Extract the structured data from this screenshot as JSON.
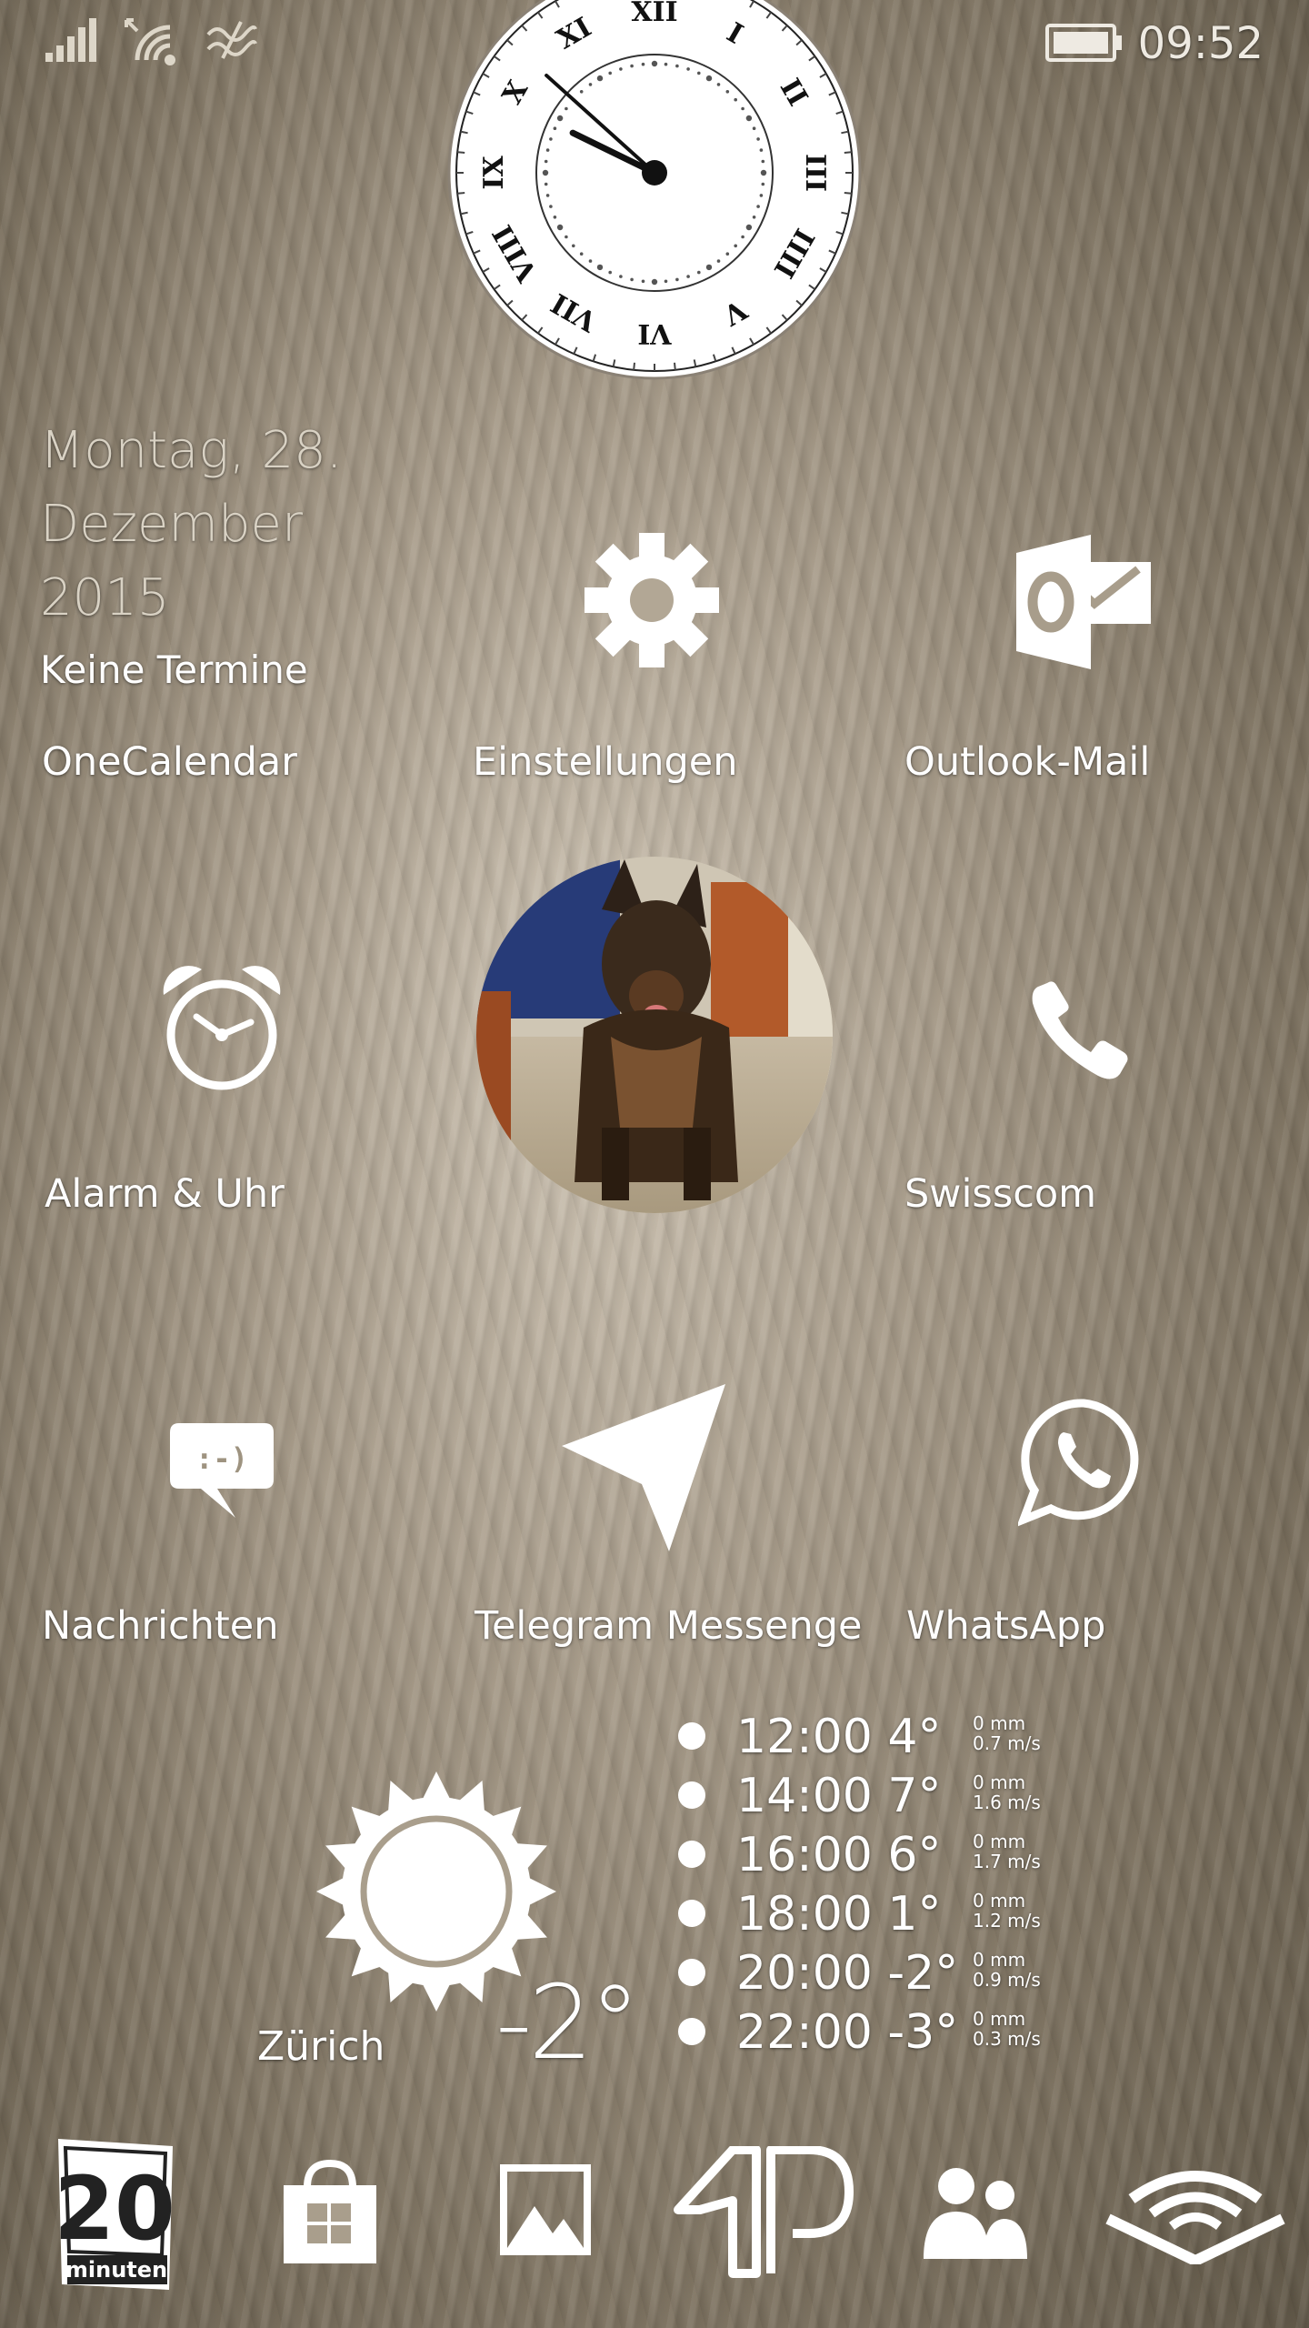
{
  "status_bar": {
    "time": "09:52",
    "icons": [
      "signal-bars-icon",
      "wifi-icon",
      "data-sense-icon",
      "battery-icon"
    ]
  },
  "clock": {
    "time_shown": "09:52"
  },
  "date_widget": {
    "line1": "Montag, 28.",
    "line2": "Dezember",
    "line3": "2015",
    "events": "Keine Termine"
  },
  "tiles": [
    {
      "label": "OneCalendar",
      "icon": "calendar-widget"
    },
    {
      "label": "Einstellungen",
      "icon": "gear-icon"
    },
    {
      "label": "Outlook-Mail",
      "icon": "outlook-icon"
    },
    {
      "label": "Alarm & Uhr",
      "icon": "alarm-clock-icon"
    },
    {
      "label": "",
      "icon": "dog-photo"
    },
    {
      "label": "Swisscom",
      "icon": "phone-icon"
    },
    {
      "label": "Nachrichten",
      "icon": "message-icon"
    },
    {
      "label": "Telegram Messenge",
      "icon": "telegram-icon"
    },
    {
      "label": "WhatsApp",
      "icon": "whatsapp-icon"
    }
  ],
  "weather": {
    "city": "Zürich",
    "current_temp": "-2°",
    "icon": "sun-icon",
    "forecast": [
      {
        "time": "12:00",
        "temp": "4°",
        "precip": "0 mm",
        "wind": "0.7 m/s"
      },
      {
        "time": "14:00",
        "temp": "7°",
        "precip": "0 mm",
        "wind": "1.6 m/s"
      },
      {
        "time": "16:00",
        "temp": "6°",
        "precip": "0 mm",
        "wind": "1.7 m/s"
      },
      {
        "time": "18:00",
        "temp": "1°",
        "precip": "0 mm",
        "wind": "1.2 m/s"
      },
      {
        "time": "20:00",
        "temp": "-2°",
        "precip": "0 mm",
        "wind": "0.9 m/s"
      },
      {
        "time": "22:00",
        "temp": "-3°",
        "precip": "0 mm",
        "wind": "0.3 m/s"
      }
    ]
  },
  "dock": {
    "items": [
      {
        "name": "20-minuten-app",
        "logo_text_1": "20",
        "logo_text_2": "minuten"
      },
      {
        "name": "store-icon"
      },
      {
        "name": "photos-icon"
      },
      {
        "name": "ap-app-icon"
      },
      {
        "name": "people-icon"
      },
      {
        "name": "audible-icon"
      }
    ]
  },
  "colors": {
    "text": "#ffffff",
    "date_text": "#d9d2c4",
    "clock_face": "#ffffff",
    "clock_marks": "#111111"
  }
}
